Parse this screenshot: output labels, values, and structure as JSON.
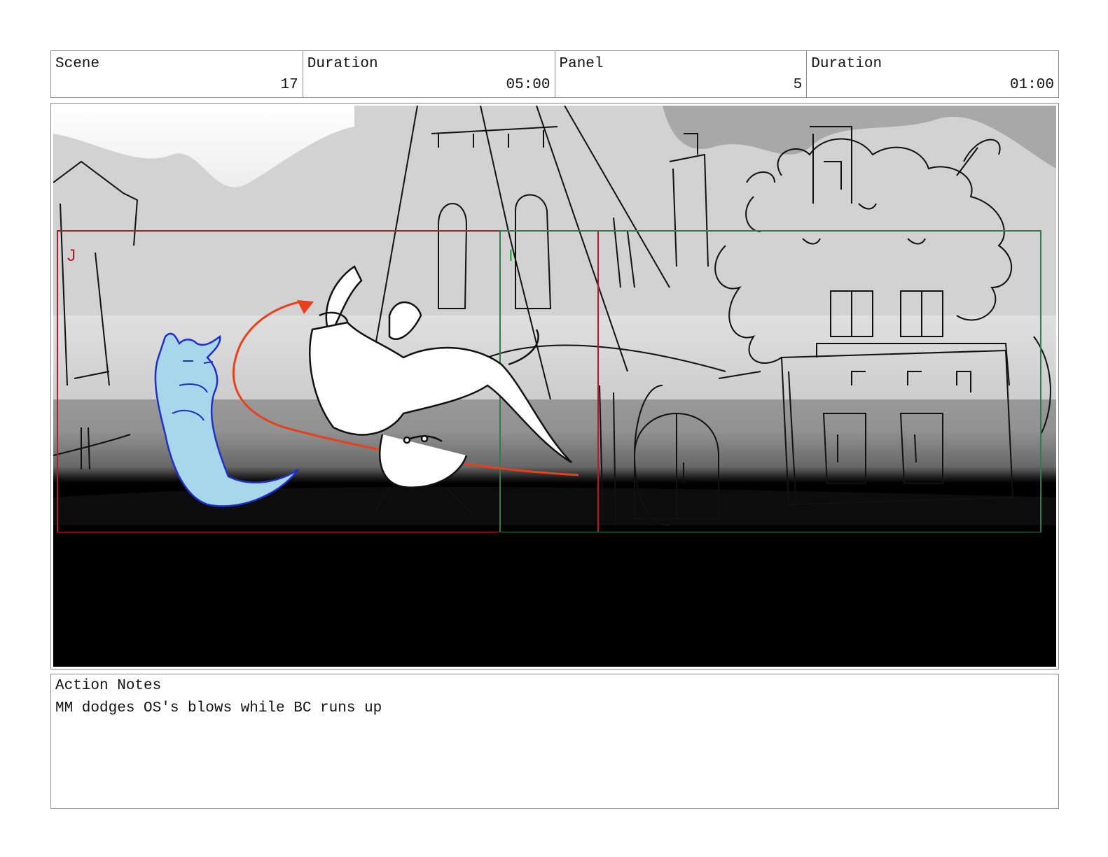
{
  "header": {
    "scene_label": "Scene",
    "scene_value": "17",
    "scene_duration_label": "Duration",
    "scene_duration_value": "05:00",
    "panel_label": "Panel",
    "panel_value": "5",
    "panel_duration_label": "Duration",
    "panel_duration_value": "01:00"
  },
  "panel": {
    "frame_markers": [
      "J",
      "I"
    ],
    "frame_colors": {
      "j_frame": "#b01c2e",
      "i_frame": "#2e7d46",
      "motion_arrow": "#e8401c",
      "ghost_character": "#2a3fd6"
    }
  },
  "notes": {
    "label": "Action Notes",
    "text": "MM dodges OS's blows while BC runs up"
  }
}
